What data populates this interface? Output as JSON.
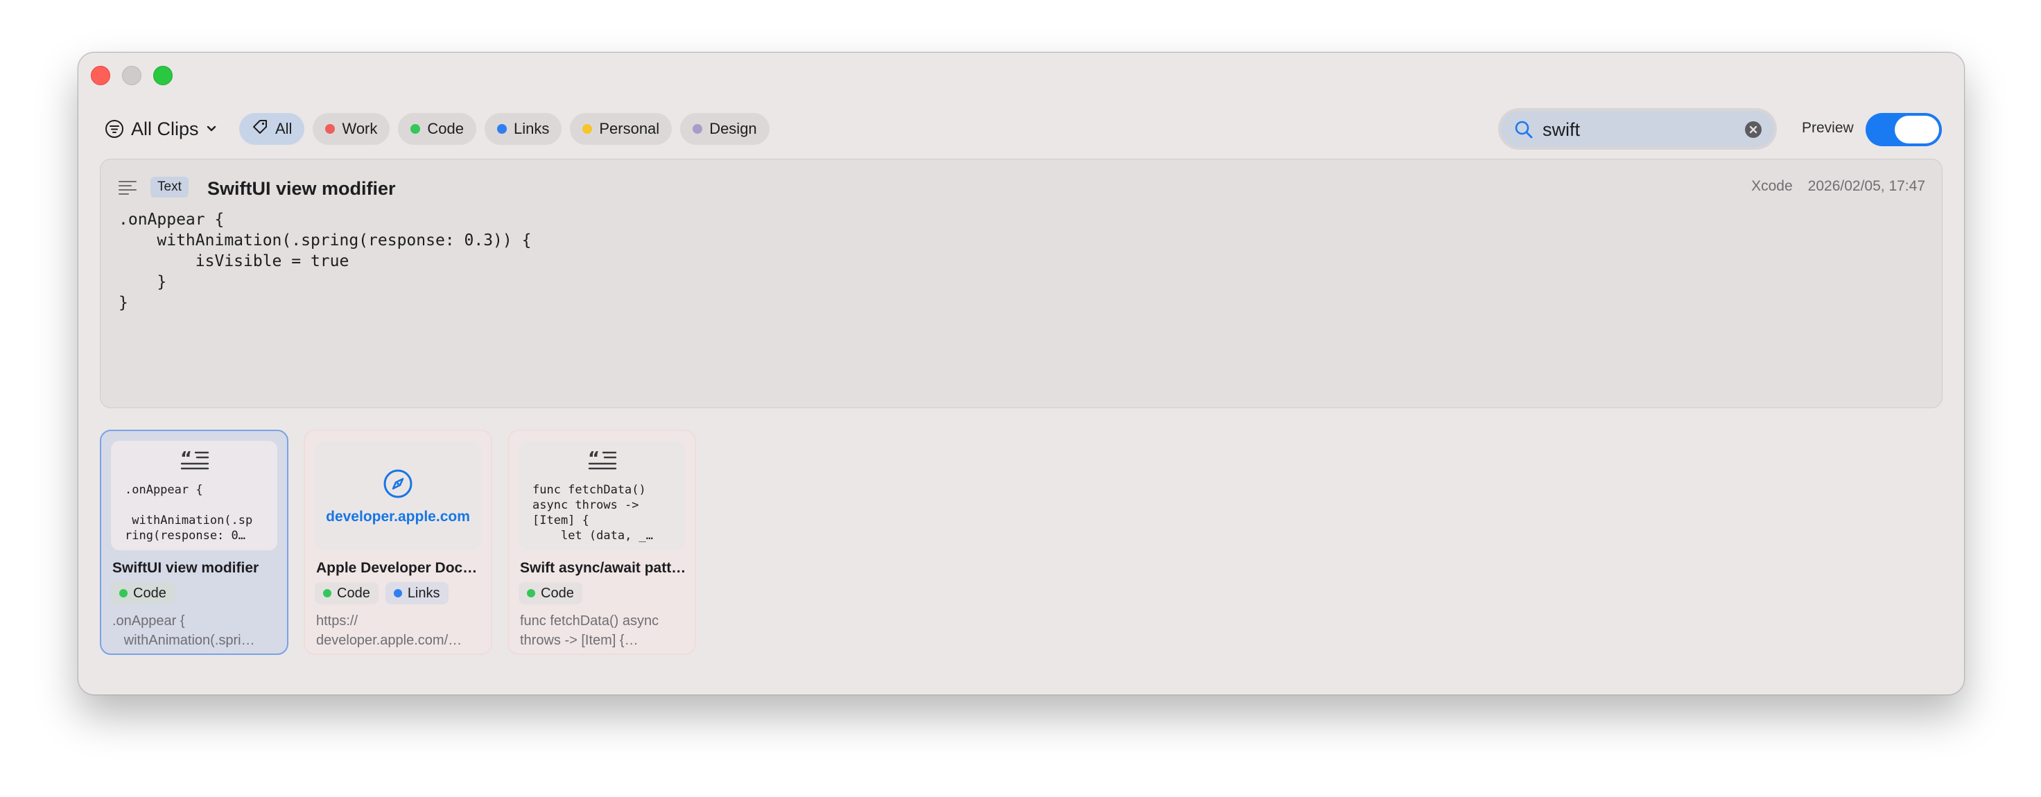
{
  "window": {
    "controls": [
      "close",
      "minimize",
      "maximize"
    ]
  },
  "toolbar": {
    "collection_label": "All Clips",
    "filters": [
      {
        "label": "All",
        "icon": "tag-icon",
        "active": true
      },
      {
        "label": "Work",
        "color": "#ee5e5e"
      },
      {
        "label": "Code",
        "color": "#34c759"
      },
      {
        "label": "Links",
        "color": "#2f7ff0"
      },
      {
        "label": "Personal",
        "color": "#f5c52a"
      },
      {
        "label": "Design",
        "color": "#a99cc8"
      }
    ],
    "search_value": "swift",
    "preview_label": "Preview",
    "preview_on": true
  },
  "preview": {
    "type_badge": "Text",
    "title": "SwiftUI view modifier",
    "source_app": "Xcode",
    "timestamp": "2026/02/05, 17:47",
    "content": ".onAppear {\n    withAnimation(.spring(response: 0.3)) {\n        isVisible = true\n    }\n}"
  },
  "clips": [
    {
      "title": "SwiftUI view modifier",
      "thumb_text": ".onAppear {\n\n withAnimation(.sp\nring(response: 0…",
      "tags": [
        {
          "label": "Code",
          "color": "#34c759"
        }
      ],
      "snippet": ".onAppear {\n   withAnimation(.spri…",
      "selected": true
    },
    {
      "title": "Apple Developer Docu…",
      "thumb_link": "developer.apple.com",
      "tags": [
        {
          "label": "Code",
          "color": "#34c759"
        },
        {
          "label": "Links",
          "color": "#2f7ff0"
        }
      ],
      "snippet": "https://\ndeveloper.apple.com/…",
      "selected": false
    },
    {
      "title": "Swift async/await patt…",
      "thumb_text": "func fetchData()\nasync throws ->\n[Item] {\n    let (data, _…",
      "tags": [
        {
          "label": "Code",
          "color": "#34c759"
        }
      ],
      "snippet": "func fetchData() async\nthrows -> [Item] {…",
      "selected": false
    }
  ]
}
